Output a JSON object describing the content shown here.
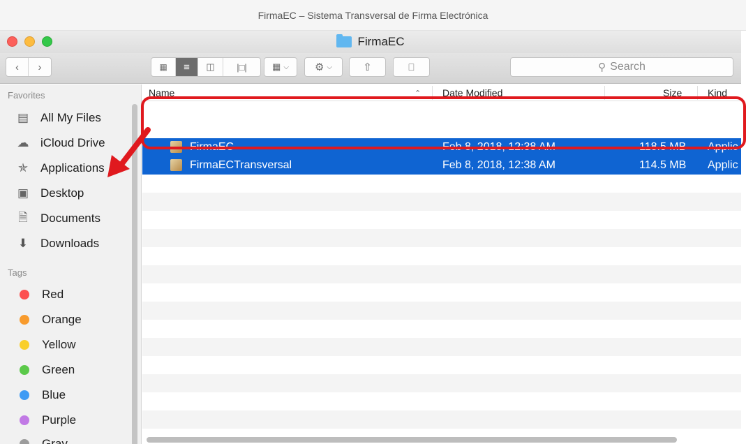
{
  "doc_title": "FirmaEC – Sistema Transversal de Firma Electrónica",
  "window": {
    "title": "FirmaEC"
  },
  "toolbar": {
    "back_icon": "chevron-left",
    "forward_icon": "chevron-right",
    "view_icon": "icon-view",
    "list_icon": "list-view",
    "column_icon": "column-view",
    "coverflow_icon": "cover-flow",
    "group_icon": "arrange",
    "action_icon": "gear",
    "share_icon": "share",
    "tag_icon": "tag",
    "search_placeholder": "Search"
  },
  "sidebar": {
    "favorites_header": "Favorites",
    "favorites": [
      {
        "label": "All My Files",
        "icon": "all-files"
      },
      {
        "label": "iCloud Drive",
        "icon": "cloud"
      },
      {
        "label": "Applications",
        "icon": "applications"
      },
      {
        "label": "Desktop",
        "icon": "desktop"
      },
      {
        "label": "Documents",
        "icon": "documents"
      },
      {
        "label": "Downloads",
        "icon": "downloads"
      }
    ],
    "tags_header": "Tags",
    "tags": [
      {
        "label": "Red",
        "color": "#fc4f4f"
      },
      {
        "label": "Orange",
        "color": "#f89b2d"
      },
      {
        "label": "Yellow",
        "color": "#f9cf2b"
      },
      {
        "label": "Green",
        "color": "#5bc94a"
      },
      {
        "label": "Blue",
        "color": "#3e9bf4"
      },
      {
        "label": "Purple",
        "color": "#c17ae5"
      },
      {
        "label": "Gray",
        "color": "#9c9c9c"
      }
    ]
  },
  "table": {
    "columns": {
      "name": "Name",
      "date": "Date Modified",
      "size": "Size",
      "kind": "Kind"
    },
    "rows": [
      {
        "name": "FirmaEC",
        "date": "Feb 8, 2018, 12:38 AM",
        "size": "118.5 MB",
        "kind": "Applic"
      },
      {
        "name": "FirmaECTransversal",
        "date": "Feb 8, 2018, 12:38 AM",
        "size": "114.5 MB",
        "kind": "Applic"
      }
    ]
  },
  "colors": {
    "selection": "#0f64d2",
    "highlight": "#e0191e"
  }
}
